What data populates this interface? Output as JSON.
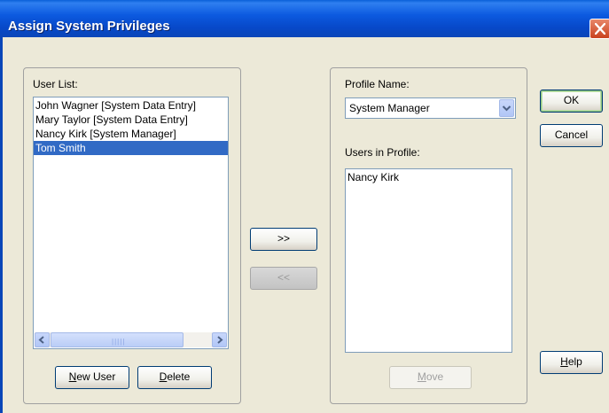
{
  "window": {
    "title": "Assign System Privileges"
  },
  "user_panel": {
    "label": "User List:",
    "users": [
      {
        "label": "John Wagner [System Data Entry]",
        "selected": false
      },
      {
        "label": "Mary Taylor [System Data Entry]",
        "selected": false
      },
      {
        "label": "Nancy Kirk [System Manager]",
        "selected": false
      },
      {
        "label": "Tom Smith",
        "selected": true
      }
    ],
    "new_user_button": {
      "label_hotkey": "N",
      "label_rest": "ew User"
    },
    "delete_button": {
      "label_hotkey": "D",
      "label_rest": "elete"
    }
  },
  "transfer": {
    "add_label": ">>",
    "remove_label": "<<"
  },
  "profile_panel": {
    "profile_name_label": "Profile Name:",
    "profile_name_value": "System Manager",
    "users_in_profile_label": "Users in Profile:",
    "users_in_profile": [
      "Nancy Kirk"
    ],
    "move_button": {
      "label_hotkey": "M",
      "label_rest": "ove"
    }
  },
  "dialog_buttons": {
    "ok_label": "OK",
    "cancel_label": "Cancel",
    "help_hotkey": "H",
    "help_rest": "elp"
  },
  "colors": {
    "titlebar": "#0a5fd8",
    "selection": "#316ac5",
    "dialog_bg": "#ece9d8"
  },
  "icons": {
    "close": "close-icon",
    "scroll_left": "arrow-left-icon",
    "scroll_right": "arrow-right-icon",
    "dropdown": "chevron-down-icon"
  }
}
